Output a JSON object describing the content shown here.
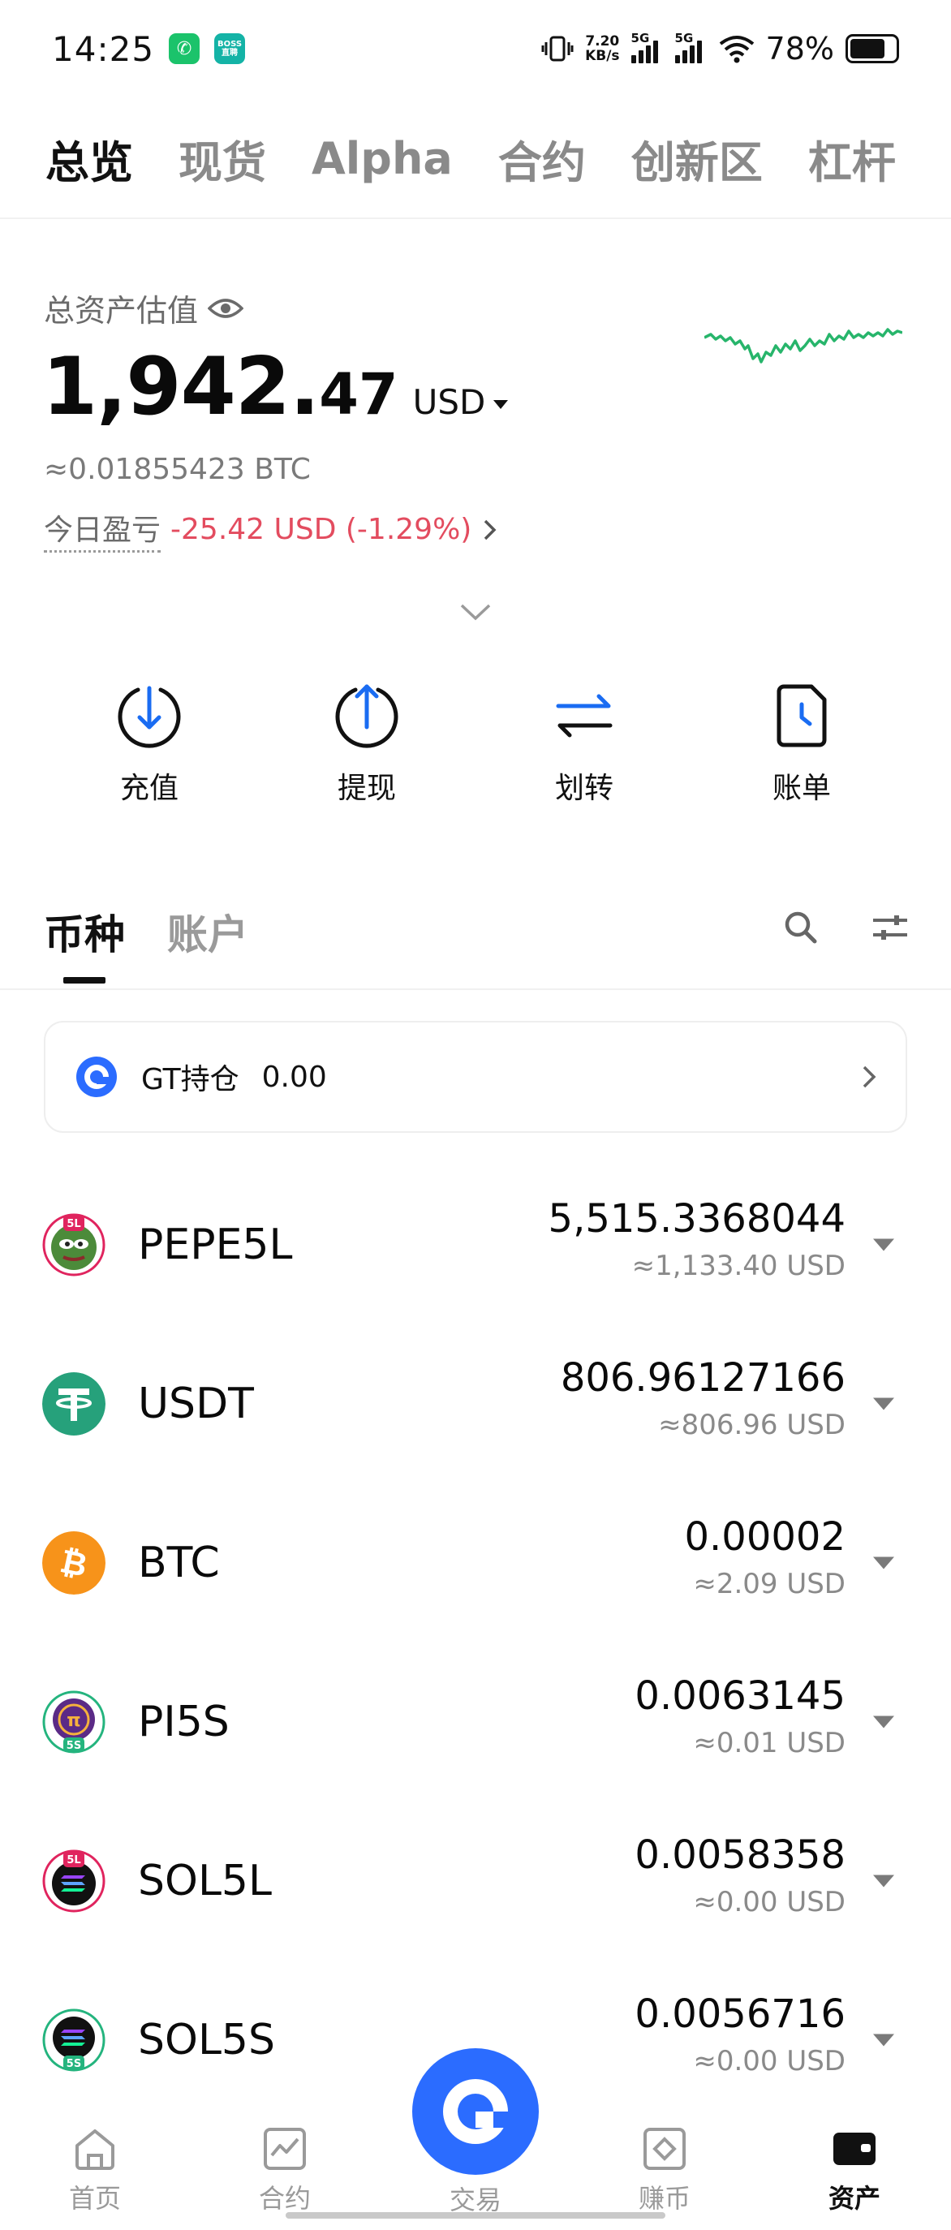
{
  "status_bar": {
    "time": "14:25",
    "app2_label": "BOSS直聘",
    "speed_value": "7.20",
    "speed_unit": "KB/s",
    "sim1": "5G",
    "sim2": "5G",
    "battery": "78%"
  },
  "top_tabs": [
    {
      "label": "总览",
      "active": true
    },
    {
      "label": "现货",
      "active": false
    },
    {
      "label": "Alpha",
      "active": false
    },
    {
      "label": "合约",
      "active": false
    },
    {
      "label": "创新区",
      "active": false
    },
    {
      "label": "杠杆",
      "active": false
    }
  ],
  "asset": {
    "label": "总资产估值",
    "total_main": "1,942.",
    "total_decimal": "47",
    "currency": "USD",
    "btc_equivalent": "≈0.01855423 BTC",
    "pnl_label": "今日盈亏",
    "pnl_value": "-25.42 USD (-1.29%)",
    "pnl_color": "#e34c5f",
    "sparkline_color": "#27b56b"
  },
  "actions": [
    {
      "label": "充值",
      "icon": "deposit-icon"
    },
    {
      "label": "提现",
      "icon": "withdraw-icon"
    },
    {
      "label": "划转",
      "icon": "transfer-icon"
    },
    {
      "label": "账单",
      "icon": "bill-icon"
    }
  ],
  "sub_tabs": [
    {
      "label": "币种",
      "active": true
    },
    {
      "label": "账户",
      "active": false
    }
  ],
  "gt_card": {
    "name": "GT持仓",
    "value": "0.00"
  },
  "coins": [
    {
      "name": "PEPE5L",
      "amount": "5,515.3368044",
      "usd": "≈1,133.40 USD",
      "badge": "5L"
    },
    {
      "name": "USDT",
      "amount": "806.96127166",
      "usd": "≈806.96 USD",
      "badge": ""
    },
    {
      "name": "BTC",
      "amount": "0.00002",
      "usd": "≈2.09 USD",
      "badge": ""
    },
    {
      "name": "PI5S",
      "amount": "0.0063145",
      "usd": "≈0.01 USD",
      "badge": "5S"
    },
    {
      "name": "SOL5L",
      "amount": "0.0058358",
      "usd": "≈0.00 USD",
      "badge": "5L"
    },
    {
      "name": "SOL5S",
      "amount": "0.0056716",
      "usd": "≈0.00 USD",
      "badge": "5S"
    }
  ],
  "bottom_nav": [
    {
      "label": "首页",
      "icon": "home-icon",
      "active": false
    },
    {
      "label": "合约",
      "icon": "futures-icon",
      "active": false
    },
    {
      "label": "交易",
      "icon": "trade-icon",
      "active": false
    },
    {
      "label": "赚币",
      "icon": "earn-icon",
      "active": false
    },
    {
      "label": "资产",
      "icon": "wallet-icon",
      "active": true
    }
  ],
  "colors": {
    "accent_blue": "#2b6cff",
    "action_blue": "#1a6cf2",
    "loss_red": "#e34c5f"
  }
}
